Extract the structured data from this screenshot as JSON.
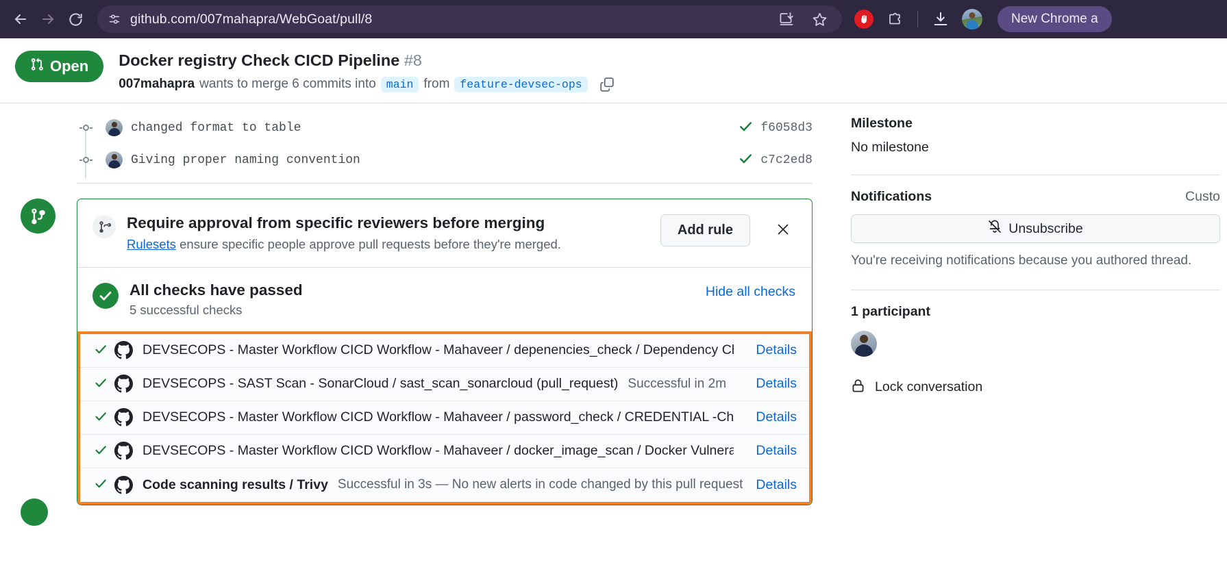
{
  "browser": {
    "url": "github.com/007mahapra/WebGoat/pull/8",
    "new_chrome_label": "New Chrome a",
    "icons": {
      "back": "back-arrow-icon",
      "forward": "forward-arrow-icon",
      "reload": "reload-icon",
      "site_settings": "site-settings-icon",
      "install": "install-app-icon",
      "bookmark": "bookmark-star-icon",
      "blocker": "stop-hand-extension-icon",
      "extensions": "extensions-puzzle-icon",
      "downloads": "downloads-icon",
      "profile": "profile-avatar-icon"
    }
  },
  "pr": {
    "state": "Open",
    "title": "Docker registry Check CICD Pipeline",
    "number": "#8",
    "author": "007mahapra",
    "merge_text_before": "wants to merge 6 commits into",
    "base_branch": "main",
    "merge_text_mid": "from",
    "head_branch": "feature-devsec-ops",
    "copy_icon": "copy-branch-icon"
  },
  "commits": [
    {
      "message": "changed format to table",
      "sha": "f6058d3",
      "status": "success"
    },
    {
      "message": "Giving proper naming convention",
      "sha": "c7c2ed8",
      "status": "success"
    }
  ],
  "ruleset_banner": {
    "icon": "branch-rule-icon",
    "title": "Require approval from specific reviewers before merging",
    "link_text": "Rulesets",
    "desc_rest": " ensure specific people approve pull requests before they're merged.",
    "add_rule_label": "Add rule",
    "dismiss_icon": "close-icon"
  },
  "checks": {
    "summary_title": "All checks have passed",
    "summary_sub": "5 successful checks",
    "hide_link": "Hide all checks",
    "details_label": "Details",
    "highlight_color": "#f28024",
    "rows": [
      {
        "name": "DEVSECOPS - Master Workflow CICD Workflow - Mahaveer / depenencies_check / Dependency Che...",
        "meta": "",
        "status": "success",
        "bold": false
      },
      {
        "name": "DEVSECOPS - SAST Scan - SonarCloud / sast_scan_sonarcloud (pull_request)",
        "meta": "Successful in 2m",
        "status": "success",
        "bold": false
      },
      {
        "name": "DEVSECOPS - Master Workflow CICD Workflow - Mahaveer / password_check / CREDENTIAL -Check...",
        "meta": "",
        "status": "success",
        "bold": false
      },
      {
        "name": "DEVSECOPS - Master Workflow CICD Workflow - Mahaveer / docker_image_scan / Docker Vulnerabi...",
        "meta": "",
        "status": "success",
        "bold": false
      },
      {
        "name": "Code scanning results / Trivy",
        "meta": "Successful in 3s — No new alerts in code changed by this pull request",
        "status": "success",
        "bold": true
      }
    ]
  },
  "sidebar": {
    "milestone_heading": "Milestone",
    "milestone_value": "No milestone",
    "notifications_heading": "Notifications",
    "notifications_customize": "Custo",
    "unsubscribe_label": "Unsubscribe",
    "unsubscribe_icon": "bell-slash-icon",
    "notif_note": "You're receiving notifications because you authored thread.",
    "participants_heading": "1 participant",
    "lock_label": "Lock conversation",
    "lock_icon": "lock-icon"
  }
}
